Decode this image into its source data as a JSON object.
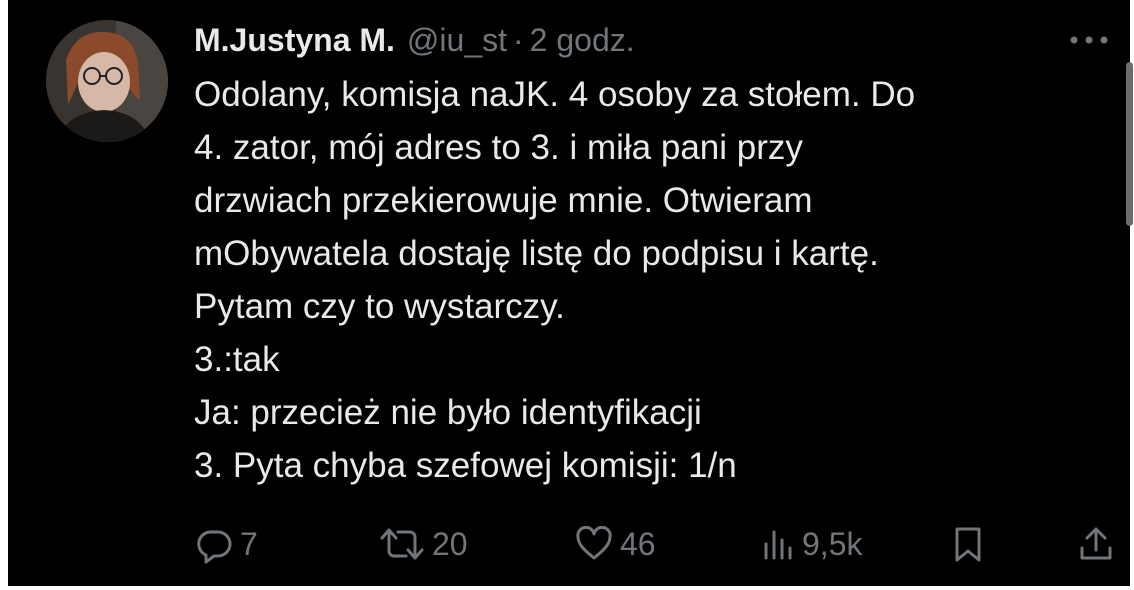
{
  "tweet": {
    "author": {
      "display_name": "M.Justyna M.",
      "handle": "@iu_st",
      "separator": "·",
      "time": "2 godz."
    },
    "more_icon": "more-horizontal-icon",
    "text_lines": [
      "Odolany, komisja naJK. 4 osoby za stołem. Do",
      "4. zator, mój adres to 3. i miła pani przy",
      "drzwiach przekierowuje mnie. Otwieram",
      "mObywatela dostaję listę do podpisu i kartę.",
      "Pytam czy to wystarczy.",
      "3.:tak",
      "Ja: przecież nie było identyfikacji",
      "3. Pyta chyba szefowej komisji:  1/n"
    ],
    "actions": {
      "reply": {
        "icon": "reply-icon",
        "count": "7"
      },
      "retweet": {
        "icon": "retweet-icon",
        "count": "20"
      },
      "like": {
        "icon": "heart-icon",
        "count": "46"
      },
      "views": {
        "icon": "views-icon",
        "count": "9,5k"
      },
      "bookmark": {
        "icon": "bookmark-icon"
      },
      "share": {
        "icon": "share-icon"
      }
    }
  },
  "colors": {
    "background": "#000000",
    "primary_text": "#e7e9ea",
    "secondary_text": "#71767b",
    "scrollbar": "#6b6b6b"
  }
}
